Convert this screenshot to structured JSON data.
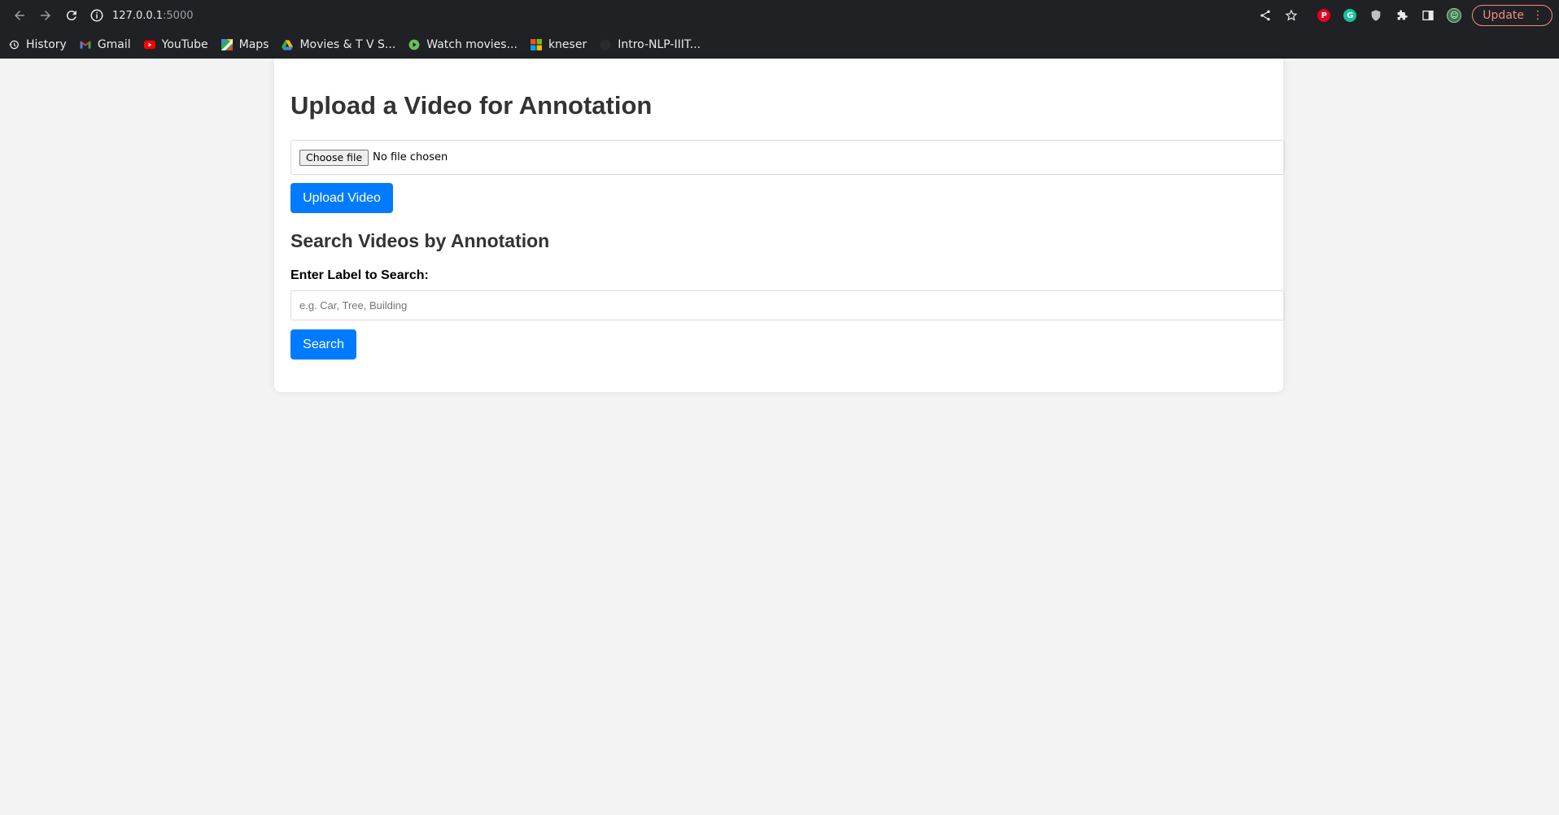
{
  "browser": {
    "url_host": "127.0.0.1",
    "url_port": ":5000",
    "update_label": "Update",
    "bookmarks": [
      {
        "label": "History",
        "icon": "history-icon"
      },
      {
        "label": "Gmail",
        "icon": "gmail-icon"
      },
      {
        "label": "YouTube",
        "icon": "youtube-icon"
      },
      {
        "label": "Maps",
        "icon": "maps-icon"
      },
      {
        "label": "Movies & T V S...",
        "icon": "drive-icon"
      },
      {
        "label": "Watch movies...",
        "icon": "play-icon"
      },
      {
        "label": "kneser",
        "icon": "microsoft-icon"
      },
      {
        "label": "Intro-NLP-IIIT...",
        "icon": "github-icon"
      }
    ]
  },
  "page": {
    "upload_title": "Upload a Video for Annotation",
    "choose_file_label": "Choose file",
    "no_file_text": "No file chosen",
    "upload_button": "Upload Video",
    "search_title": "Search Videos by Annotation",
    "search_label": "Enter Label to Search:",
    "search_placeholder": "e.g. Car, Tree, Building",
    "search_button": "Search"
  },
  "colors": {
    "accent": "#007bff",
    "page_bg": "#f3f3f3",
    "browser_bg": "#202124",
    "update_red": "#f28b82"
  }
}
